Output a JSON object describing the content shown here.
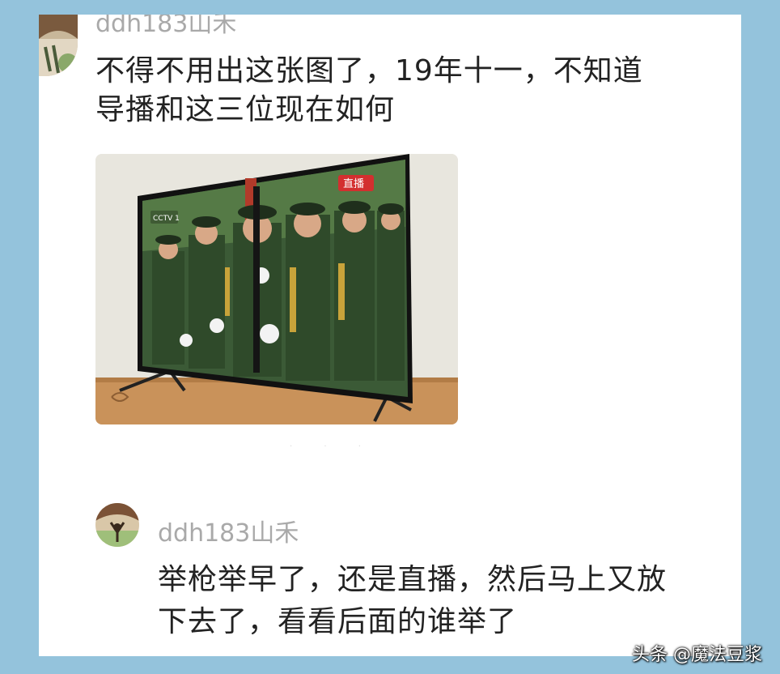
{
  "comments": [
    {
      "username": "ddh183山禾",
      "lines": [
        "不得不用出这张图了，19年十一，不知道",
        "导播和这三位现在如何"
      ]
    },
    {
      "username": "ddh183山禾",
      "lines": [
        "举枪举早了，还是直播，然后马上又放",
        "下去了，看看后面的谁举了"
      ]
    }
  ],
  "photo": {
    "channel_logo": "CCTV 1",
    "live_badge": "直播"
  },
  "watermark": "头条 @魔法豆浆"
}
